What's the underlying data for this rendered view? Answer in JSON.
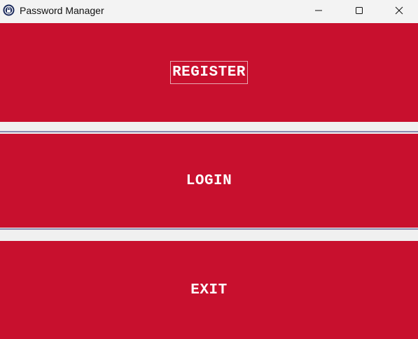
{
  "window": {
    "title": "Password Manager"
  },
  "controls": {
    "minimize_icon": "minimize-icon",
    "maximize_icon": "maximize-icon",
    "close_icon": "close-icon"
  },
  "buttons": {
    "register": "REGISTER",
    "login": "LOGIN",
    "exit": "EXIT"
  },
  "colors": {
    "button_bg": "#c8102e",
    "button_text": "#ffffff",
    "separator_line": "#8a8ab0"
  }
}
